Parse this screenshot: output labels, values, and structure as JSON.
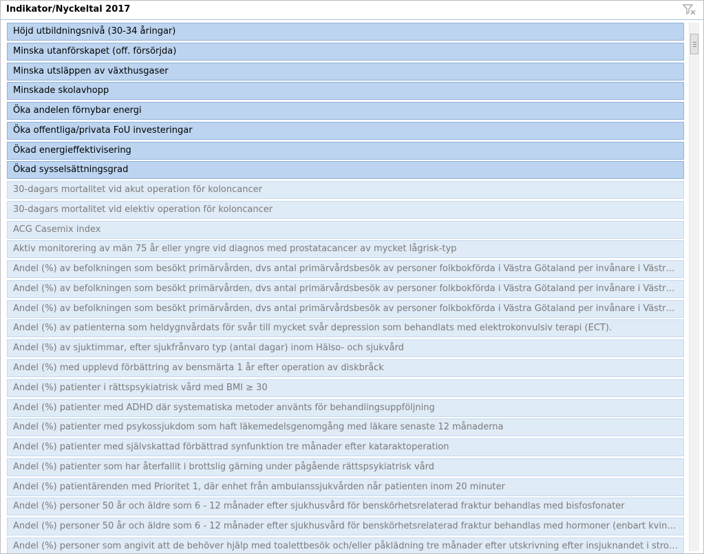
{
  "slicer": {
    "title": "Indikator/Nyckeltal 2017",
    "clear_filter_icon": "clear-filter-icon"
  },
  "items": [
    {
      "label": "Höjd utbildningsnivå (30-34 åringar)",
      "selected": true
    },
    {
      "label": "Minska utanförskapet (off. försörjda)",
      "selected": true
    },
    {
      "label": "Minska utsläppen av växthusgaser",
      "selected": true
    },
    {
      "label": "Minskade skolavhopp",
      "selected": true
    },
    {
      "label": "Öka andelen förnybar energi",
      "selected": true
    },
    {
      "label": "Öka offentliga/privata FoU investeringar",
      "selected": true
    },
    {
      "label": "Ökad energieffektivisering",
      "selected": true
    },
    {
      "label": "Ökad sysselsättningsgrad",
      "selected": true
    },
    {
      "label": "30-dagars mortalitet vid akut operation för koloncancer",
      "selected": false
    },
    {
      "label": "30-dagars mortalitet vid elektiv operation för koloncancer",
      "selected": false
    },
    {
      "label": "ACG Casemix index",
      "selected": false
    },
    {
      "label": "Aktiv monitorering av män 75 år eller yngre vid diagnos med prostatacancer av mycket lågrisk-typ",
      "selected": false
    },
    {
      "label": "Andel (%) av befolkningen som besökt primärvården, dvs antal primärvårdsbesök av personer folkbokförda i Västra Götaland per invånare i Västra Götaland, per v...",
      "selected": false
    },
    {
      "label": "Andel (%) av befolkningen som besökt primärvården, dvs antal primärvårdsbesök av personer folkbokförda i Västra Götaland per invånare i Västra Götaland, per ...",
      "selected": false
    },
    {
      "label": "Andel (%) av befolkningen som besökt primärvården, dvs antal primärvårdsbesök av personer folkbokförda i Västra Götaland per invånare i Västra Götaland. Möd...",
      "selected": false
    },
    {
      "label": "Andel (%) av patienterna som heldygnvårdats för svår till mycket svår depression som behandlats med elektrokonvulsiv terapi (ECT).",
      "selected": false
    },
    {
      "label": "Andel (%) av sjuktimmar, efter sjukfrånvaro typ (antal dagar) inom Hälso- och sjukvård",
      "selected": false
    },
    {
      "label": "Andel (%) med upplevd förbättring av bensmärta 1 år efter operation av diskbråck",
      "selected": false
    },
    {
      "label": "Andel (%) patienter i rättspsykiatrisk vård med BMI ≥ 30",
      "selected": false
    },
    {
      "label": "Andel (%) patienter med ADHD där systematiska metoder använts för behandlingsuppföljning",
      "selected": false
    },
    {
      "label": "Andel (%) patienter med psykossjukdom som haft läkemedelsgenomgång med läkare senaste 12 månaderna",
      "selected": false
    },
    {
      "label": "Andel (%) patienter med självskattad förbättrad synfunktion tre månader efter kataraktoperation",
      "selected": false
    },
    {
      "label": "Andel (%) patienter som har återfallit i brottslig gärning under pågående rättspsykiatrisk vård",
      "selected": false
    },
    {
      "label": "Andel (%) patientärenden med Prioritet 1, där enhet från ambulanssjukvården når patienten inom 20 minuter",
      "selected": false
    },
    {
      "label": "Andel (%) personer 50 år och äldre som 6 - 12 månader efter sjukhusvård för benskörhetsrelaterad fraktur behandlas med bisfosfonater",
      "selected": false
    },
    {
      "label": "Andel (%) personer 50 år och äldre som 6 - 12 månader efter sjukhusvård för benskörhetsrelaterad fraktur behandlas med hormoner (enbart kvinnor)",
      "selected": false
    },
    {
      "label": "Andel (%) personer som angivit att de behöver hjälp med toalettbesök och/eller påklädning tre månader efter utskrivning efter insjuknandet i stroke.",
      "selected": false
    }
  ]
}
